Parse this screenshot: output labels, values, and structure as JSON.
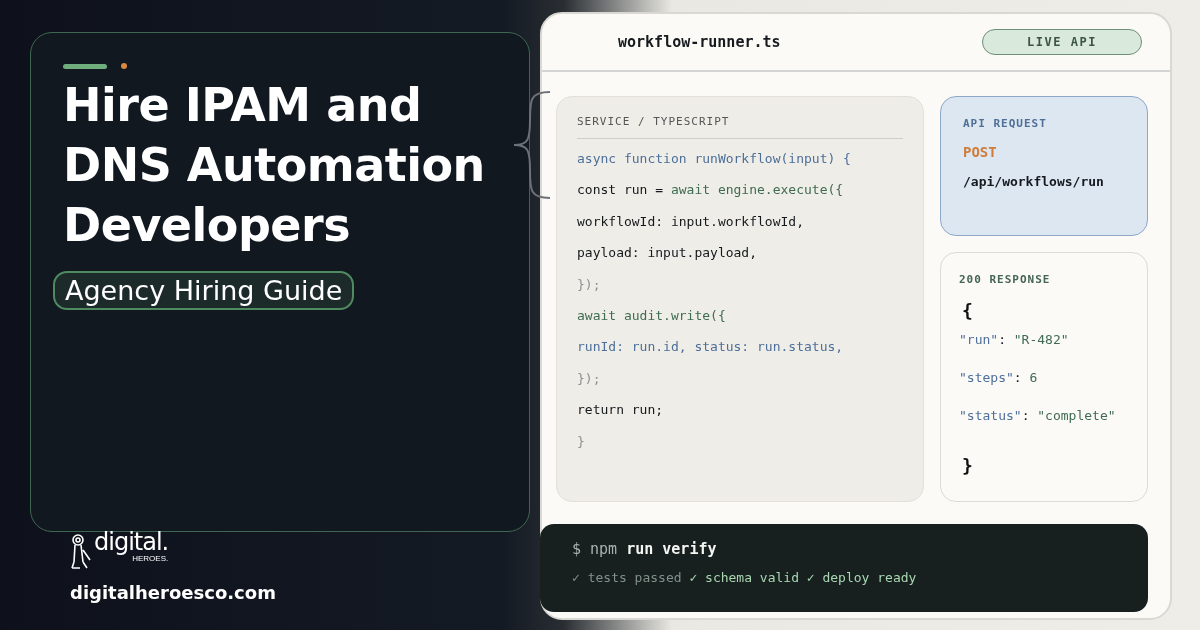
{
  "hero": {
    "title_lines": [
      "Hire IPAM and",
      "DNS Automation",
      "Developers"
    ],
    "tag": "Agency Hiring Guide"
  },
  "brand": {
    "logo_word": "digital.",
    "logo_sub": "HEROES.",
    "url": "digitalheroesco.com"
  },
  "editor": {
    "filename": "workflow-runner.ts",
    "badge": "LIVE API",
    "code_label": "SERVICE / TYPESCRIPT",
    "code_lines": [
      [
        {
          "kind": "blue",
          "text": "async function runWorkflow(input) {"
        }
      ],
      [
        {
          "kind": "plain",
          "text": "const run = "
        },
        {
          "kind": "green",
          "text": "await engine.execute({"
        }
      ],
      [
        {
          "kind": "plain",
          "text": "workflowId: input.workflowId,"
        }
      ],
      [
        {
          "kind": "plain",
          "text": "payload: input.payload,"
        }
      ],
      [
        {
          "kind": "muted",
          "text": "});"
        }
      ],
      [
        {
          "kind": "green",
          "text": "await audit.write({"
        }
      ],
      [
        {
          "kind": "blue",
          "text": "runId: run.id, status: run.status,"
        }
      ],
      [
        {
          "kind": "muted",
          "text": "});"
        }
      ],
      [
        {
          "kind": "plain",
          "text": "return run;"
        }
      ],
      [
        {
          "kind": "muted",
          "text": "}"
        }
      ]
    ],
    "request": {
      "label": "API REQUEST",
      "method": "POST",
      "path": "/api/workflows/run"
    },
    "response": {
      "label": "200 RESPONSE",
      "open": "{",
      "close": "}",
      "fields": [
        [
          {
            "kind": "blue",
            "text": "\"run\""
          },
          {
            "kind": "plain",
            "text": ": "
          },
          {
            "kind": "green",
            "text": "\"R-482\""
          }
        ],
        [
          {
            "kind": "blue",
            "text": "\"steps\""
          },
          {
            "kind": "plain",
            "text": ": "
          },
          {
            "kind": "green",
            "text": "6"
          }
        ],
        [
          {
            "kind": "blue",
            "text": "\"status\""
          },
          {
            "kind": "plain",
            "text": ": "
          },
          {
            "kind": "green",
            "text": "\"complete\""
          }
        ]
      ]
    },
    "terminal": {
      "lines": [
        [
          {
            "kind": "prompt",
            "text": "$ npm"
          },
          {
            "kind": "command",
            "text": " run verify"
          }
        ],
        [
          {
            "kind": "faded",
            "text": "✓ tests passed"
          },
          {
            "kind": "ok",
            "text": " ✓ schema valid ✓ deploy ready"
          }
        ]
      ]
    }
  }
}
